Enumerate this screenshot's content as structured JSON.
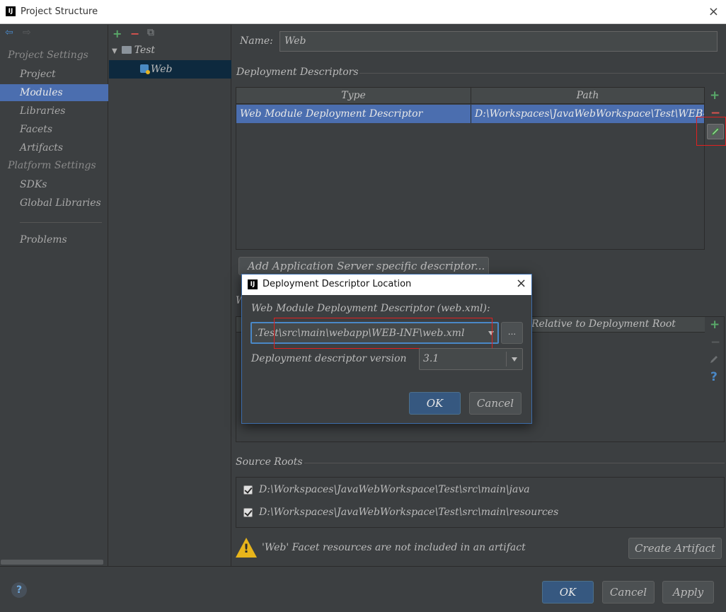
{
  "window": {
    "title": "Project Structure",
    "logo_text": "IJ",
    "close_glyph": "×"
  },
  "nav": {
    "back_glyph": "⇦",
    "forward_glyph": "⇨",
    "project_settings_heading": "Project Settings",
    "items_project": [
      "Project",
      "Modules",
      "Libraries",
      "Facets",
      "Artifacts"
    ],
    "platform_settings_heading": "Platform Settings",
    "items_platform": [
      "SDKs",
      "Global Libraries"
    ],
    "problems": "Problems",
    "selected": "Modules"
  },
  "tree": {
    "add_glyph": "+",
    "remove_glyph": "−",
    "copy_glyph": "⧉",
    "expand_glyph": "▼",
    "root": "Test",
    "child": "Web"
  },
  "module": {
    "name_label": "Name:",
    "name_value": "Web"
  },
  "deployment_descriptors": {
    "heading": "Deployment Descriptors",
    "columns": [
      "Type",
      "Path"
    ],
    "rows": [
      {
        "type": "Web Module Deployment Descriptor",
        "path": "D:\\Workspaces\\JavaWebWorkspace\\Test\\WEB-INF\\web.xml"
      }
    ],
    "add_glyph": "+",
    "remove_glyph": "−",
    "add_server_button": "Add Application Server specific descriptor..."
  },
  "web_resource_dirs": {
    "heading_partial": "W",
    "column_relative": "Relative to Deployment Root",
    "help_glyph": "?"
  },
  "source_roots": {
    "heading": "Source Roots",
    "items": [
      "D:\\Workspaces\\JavaWebWorkspace\\Test\\src\\main\\java",
      "D:\\Workspaces\\JavaWebWorkspace\\Test\\src\\main\\resources"
    ]
  },
  "warning": {
    "text": "'Web' Facet resources are not included in an artifact",
    "button": "Create Artifact"
  },
  "footer": {
    "help_glyph": "?",
    "ok": "OK",
    "cancel": "Cancel",
    "apply": "Apply"
  },
  "dialog": {
    "title": "Deployment Descriptor Location",
    "logo_text": "IJ",
    "close_glyph": "×",
    "path_label": "Web Module Deployment Descriptor (web.xml):",
    "path_value": ".Test\\src\\main\\webapp\\WEB-INF\\web.xml",
    "browse_glyph": "...",
    "version_label": "Deployment descriptor version",
    "version_value": "3.1",
    "ok": "OK",
    "cancel": "Cancel"
  },
  "colors": {
    "background": "#3c3f41",
    "selection": "#4b6eaf",
    "default_button": "#365880",
    "highlight_box": "#e02020",
    "warning_icon": "#e8b51b"
  }
}
